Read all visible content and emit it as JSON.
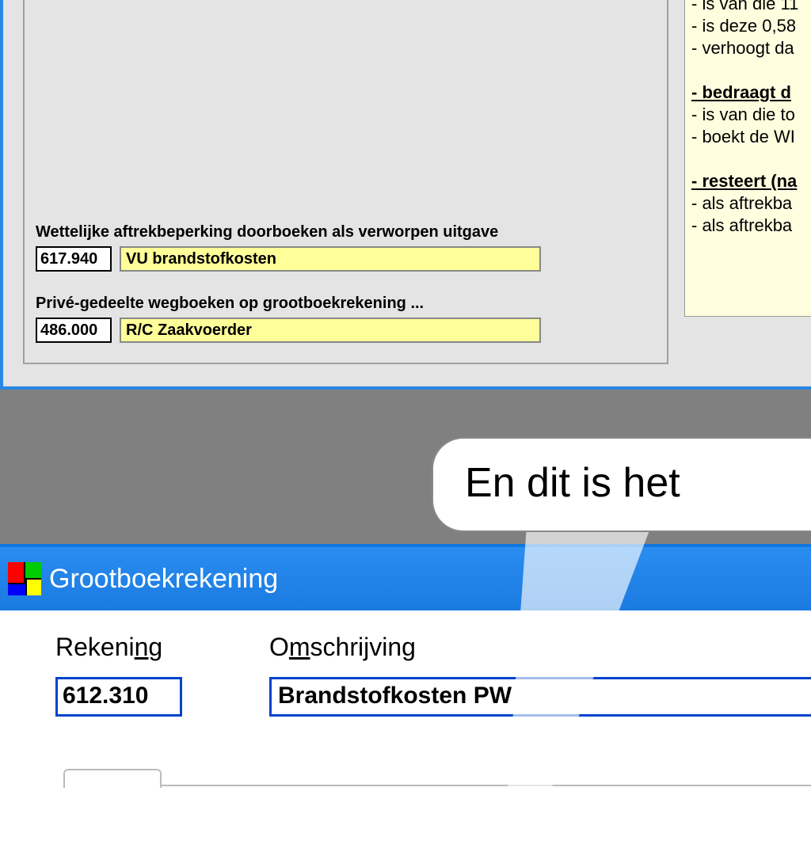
{
  "upper": {
    "field1": {
      "label": "Wettelijke aftrekbeperking doorboeken als verworpen uitgave",
      "code": "617.940",
      "desc": "VU brandstofkosten"
    },
    "field2": {
      "label": "Privé-gedeelte wegboeken op grootboekrekening ...",
      "code": "486.000",
      "desc": "R/C Zaakvoerder"
    }
  },
  "note": {
    "l1": "- is van die 11",
    "l2": "- is deze 0,58",
    "l3": "- verhoogt da",
    "h1": "- bedraagt d",
    "l4": "- is van die to",
    "l5": "- boekt de WI",
    "h2": "- resteert (na",
    "l6": "- als aftrekba",
    "l7": "- als aftrekba"
  },
  "bubble": {
    "text": "En dit is het"
  },
  "lower": {
    "title": "Grootboekrekening",
    "rek_label_pre": "Rekeni",
    "rek_label_ul": "n",
    "rek_label_post": "g",
    "oms_label_pre": "O",
    "oms_label_ul": "m",
    "oms_label_post": "schrijving",
    "rek_value": "612.310",
    "oms_value": "Brandstofkosten PW"
  }
}
